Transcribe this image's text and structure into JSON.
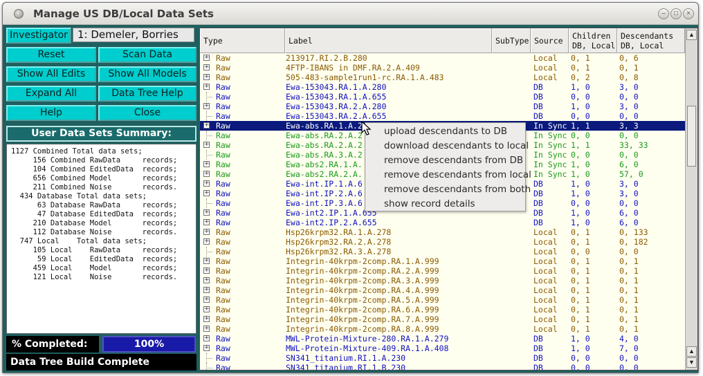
{
  "window": {
    "title": "Manage US DB/Local Data Sets"
  },
  "left": {
    "investigator_button": "Investigator",
    "investigator_value": "1: Demeler, Borries",
    "buttons": {
      "reset": "Reset",
      "scan": "Scan Data",
      "show_edits": "Show All Edits",
      "show_models": "Show All Models",
      "expand": "Expand All",
      "help_tree": "Data Tree Help",
      "help": "Help",
      "close": "Close"
    },
    "summary_title": "User Data Sets Summary:",
    "summary_lines": [
      "1127 Combined Total data sets;",
      "     156 Combined RawData     records;",
      "     104 Combined EditedData  records;",
      "     656 Combined Model       records;",
      "     211 Combined Noise       records.",
      "  434 Database Total data sets;",
      "      63 Database RawData     records;",
      "      47 Database EditedData  records;",
      "     210 Database Model       records;",
      "     112 Database Noise       records.",
      "  747 Local    Total data sets;",
      "     105 Local    RawData     records;",
      "      59 Local    EditedData  records;",
      "     459 Local    Model       records;",
      "     121 Local    Noise       records."
    ],
    "completed_label": "% Completed:",
    "completed_value": "100%",
    "completed_fraction": 1.0,
    "status": "Data Tree Build Complete"
  },
  "tree": {
    "headers": {
      "type": "Type",
      "label": "Label",
      "subtype": "SubType",
      "source": "Source",
      "children_1": "Children",
      "children_2": "DB, Local",
      "desc_1": "Descendants",
      "desc_2": "DB, Local"
    },
    "colors": {
      "local": "#8a5a00",
      "db": "#1010c0",
      "sync": "#1a9a1a"
    },
    "rows": [
      {
        "exp": true,
        "type": "Raw",
        "label": "213917.RI.2.B.280",
        "source": "Local",
        "children": "0, 1",
        "desc": "0, 6",
        "kind": "local"
      },
      {
        "exp": true,
        "type": "Raw",
        "label": "4FTP-IBANS in DMF.RA.2.A.409",
        "source": "Local",
        "children": "0, 1",
        "desc": "0, 1",
        "kind": "local"
      },
      {
        "exp": true,
        "type": "Raw",
        "label": "505-483-sample1run1-rc.RA.1.A.483",
        "source": "Local",
        "children": "0, 2",
        "desc": "0, 8",
        "kind": "local"
      },
      {
        "exp": true,
        "type": "Raw",
        "label": "Ewa-153043.RA.1.A.280",
        "source": "DB",
        "children": "1, 0",
        "desc": "3, 0",
        "kind": "db"
      },
      {
        "exp": false,
        "type": "Raw",
        "label": "Ewa-153043.RA.1.A.655",
        "source": "DB",
        "children": "0, 0",
        "desc": "0, 0",
        "kind": "db"
      },
      {
        "exp": true,
        "type": "Raw",
        "label": "Ewa-153043.RA.2.A.280",
        "source": "DB",
        "children": "1, 0",
        "desc": "3, 0",
        "kind": "db"
      },
      {
        "exp": false,
        "type": "Raw",
        "label": "Ewa-153043.RA.2.A.655",
        "source": "DB",
        "children": "0, 0",
        "desc": "0, 0",
        "kind": "db"
      },
      {
        "exp": true,
        "type": "Raw",
        "label": "Ewa-abs.RA.1.A.2",
        "source": "In Sync",
        "children": "1, 1",
        "desc": "3, 3",
        "kind": "sync",
        "selected": true
      },
      {
        "exp": false,
        "type": "Raw",
        "label": "Ewa-abs.RA.2.A.2",
        "source": "In Sync",
        "children": "0, 0",
        "desc": "0, 0",
        "kind": "sync"
      },
      {
        "exp": true,
        "type": "Raw",
        "label": "Ewa-abs.RA.2.A.2",
        "source": "In Sync",
        "children": "1, 1",
        "desc": "33, 33",
        "kind": "sync"
      },
      {
        "exp": false,
        "type": "Raw",
        "label": "Ewa-abs.RA.3.A.2",
        "source": "In Sync",
        "children": "0, 0",
        "desc": "0, 0",
        "kind": "sync"
      },
      {
        "exp": true,
        "type": "Raw",
        "label": "Ewa-abs2.RA.1.A.",
        "source": "In Sync",
        "children": "1, 0",
        "desc": "6, 0",
        "kind": "sync"
      },
      {
        "exp": true,
        "type": "Raw",
        "label": "Ewa-abs2.RA.2.A.",
        "source": "In Sync",
        "children": "1, 0",
        "desc": "57, 0",
        "kind": "sync"
      },
      {
        "exp": true,
        "type": "Raw",
        "label": "Ewa-int.IP.1.A.6",
        "source": "DB",
        "children": "1, 0",
        "desc": "3, 0",
        "kind": "db"
      },
      {
        "exp": true,
        "type": "Raw",
        "label": "Ewa-int.IP.2.A.6",
        "source": "DB",
        "children": "1, 0",
        "desc": "3, 0",
        "kind": "db"
      },
      {
        "exp": false,
        "type": "Raw",
        "label": "Ewa-int.IP.3.A.6",
        "source": "DB",
        "children": "0, 0",
        "desc": "0, 0",
        "kind": "db"
      },
      {
        "exp": true,
        "type": "Raw",
        "label": "Ewa-int2.IP.1.A.655",
        "source": "DB",
        "children": "1, 0",
        "desc": "6, 0",
        "kind": "db"
      },
      {
        "exp": true,
        "type": "Raw",
        "label": "Ewa-int2.IP.2.A.655",
        "source": "DB",
        "children": "1, 0",
        "desc": "6, 0",
        "kind": "db"
      },
      {
        "exp": true,
        "type": "Raw",
        "label": "Hsp26krpm32.RA.1.A.278",
        "source": "Local",
        "children": "0, 1",
        "desc": "0, 133",
        "kind": "local"
      },
      {
        "exp": true,
        "type": "Raw",
        "label": "Hsp26krpm32.RA.2.A.278",
        "source": "Local",
        "children": "0, 1",
        "desc": "0, 182",
        "kind": "local"
      },
      {
        "exp": false,
        "type": "Raw",
        "label": "Hsp26krpm32.RA.3.A.278",
        "source": "Local",
        "children": "0, 0",
        "desc": "0, 0",
        "kind": "local"
      },
      {
        "exp": true,
        "type": "Raw",
        "label": "Integrin-40krpm-2comp.RA.1.A.999",
        "source": "Local",
        "children": "0, 1",
        "desc": "0, 1",
        "kind": "local"
      },
      {
        "exp": true,
        "type": "Raw",
        "label": "Integrin-40krpm-2comp.RA.2.A.999",
        "source": "Local",
        "children": "0, 1",
        "desc": "0, 1",
        "kind": "local"
      },
      {
        "exp": true,
        "type": "Raw",
        "label": "Integrin-40krpm-2comp.RA.3.A.999",
        "source": "Local",
        "children": "0, 1",
        "desc": "0, 1",
        "kind": "local"
      },
      {
        "exp": true,
        "type": "Raw",
        "label": "Integrin-40krpm-2comp.RA.4.A.999",
        "source": "Local",
        "children": "0, 1",
        "desc": "0, 1",
        "kind": "local"
      },
      {
        "exp": true,
        "type": "Raw",
        "label": "Integrin-40krpm-2comp.RA.5.A.999",
        "source": "Local",
        "children": "0, 1",
        "desc": "0, 1",
        "kind": "local"
      },
      {
        "exp": true,
        "type": "Raw",
        "label": "Integrin-40krpm-2comp.RA.6.A.999",
        "source": "Local",
        "children": "0, 1",
        "desc": "0, 1",
        "kind": "local"
      },
      {
        "exp": true,
        "type": "Raw",
        "label": "Integrin-40krpm-2comp.RA.7.A.999",
        "source": "Local",
        "children": "0, 1",
        "desc": "0, 1",
        "kind": "local"
      },
      {
        "exp": true,
        "type": "Raw",
        "label": "Integrin-40krpm-2comp.RA.8.A.999",
        "source": "Local",
        "children": "0, 1",
        "desc": "0, 1",
        "kind": "local"
      },
      {
        "exp": true,
        "type": "Raw",
        "label": "MWL-Protein-Mixture-280.RA.1.A.279",
        "source": "DB",
        "children": "1, 0",
        "desc": "4, 0",
        "kind": "db"
      },
      {
        "exp": true,
        "type": "Raw",
        "label": "MWL-Protein-Mixture-409.RA.1.A.408",
        "source": "DB",
        "children": "1, 0",
        "desc": "7, 0",
        "kind": "db"
      },
      {
        "exp": false,
        "type": "Raw",
        "label": "SN341_titanium.RI.1.A.230",
        "source": "DB",
        "children": "0, 0",
        "desc": "0, 0",
        "kind": "db"
      },
      {
        "exp": false,
        "type": "Raw",
        "label": "SN341_titanium.RI.1.B.230",
        "source": "DB",
        "children": "0, 0",
        "desc": "0, 0",
        "kind": "db"
      }
    ]
  },
  "context_menu": [
    "upload descendants to DB",
    "download descendants to local",
    "remove descendants from DB",
    "remove descendants from local",
    "remove descendants from both",
    "show record details"
  ]
}
